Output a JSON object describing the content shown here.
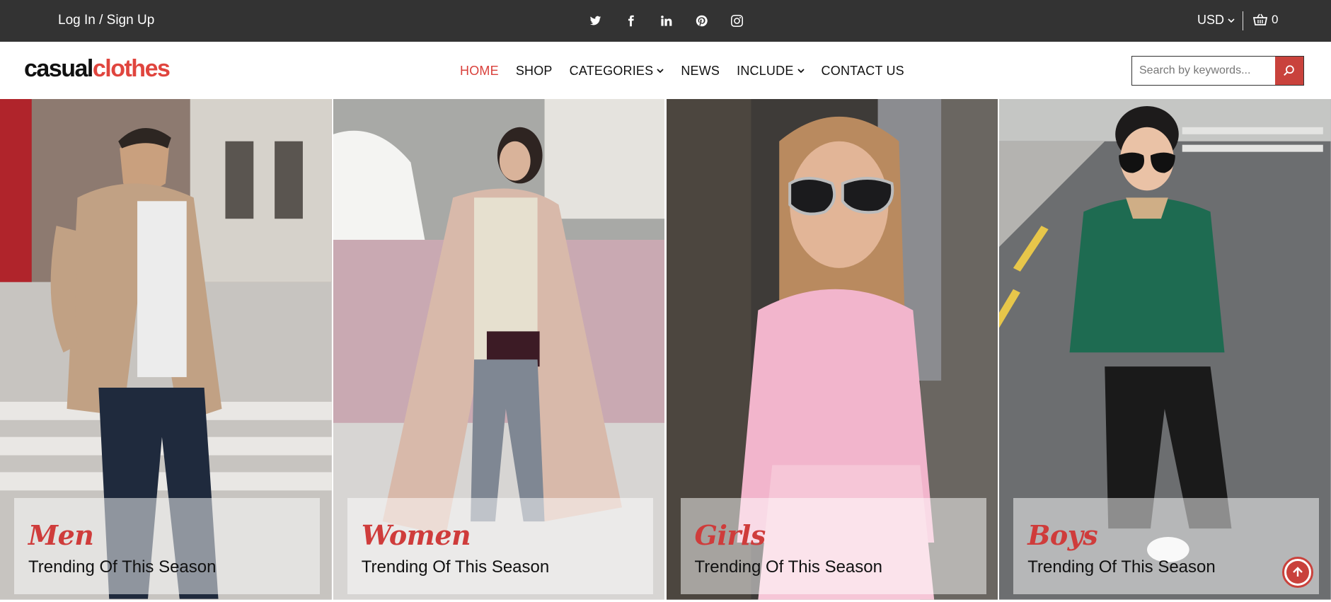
{
  "topbar": {
    "login_label": "Log In / Sign Up",
    "social": [
      "twitter-icon",
      "facebook-icon",
      "linkedin-icon",
      "pinterest-icon",
      "instagram-icon"
    ],
    "currency": "USD",
    "cart_count": "0"
  },
  "header": {
    "logo_part1": "casual",
    "logo_part2": "clothes",
    "nav": [
      {
        "label": "HOME",
        "active": true
      },
      {
        "label": "SHOP"
      },
      {
        "label": "CATEGORIES",
        "dropdown": true
      },
      {
        "label": "NEWS"
      },
      {
        "label": "INCLUDE",
        "dropdown": true
      },
      {
        "label": "CONTACT US"
      }
    ],
    "search_placeholder": "Search by keywords..."
  },
  "banner": [
    {
      "title": "Men",
      "subtitle": "Trending Of This Season"
    },
    {
      "title": "Women",
      "subtitle": "Trending Of This Season"
    },
    {
      "title": "Girls",
      "subtitle": "Trending Of This Season"
    },
    {
      "title": "Boys",
      "subtitle": "Trending Of This Season"
    }
  ],
  "colors": {
    "topbar_bg": "#333333",
    "accent": "#c9423c",
    "logo_accent": "#e0453e"
  }
}
